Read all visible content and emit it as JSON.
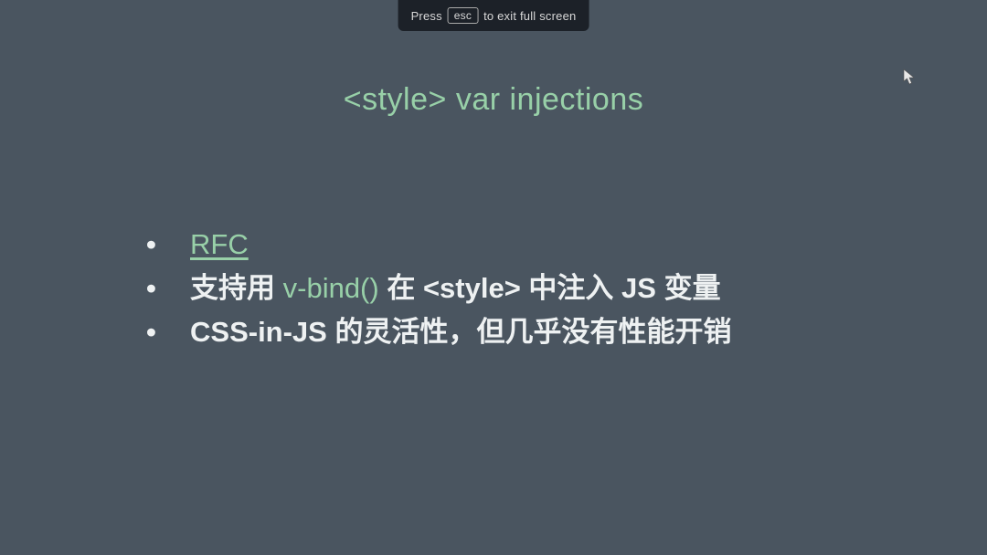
{
  "hint": {
    "press": "Press",
    "key": "esc",
    "rest": "to exit full screen"
  },
  "slide": {
    "title": "<style> var injections",
    "bullets": [
      {
        "parts": [
          {
            "text": "RFC",
            "kind": "link"
          }
        ]
      },
      {
        "parts": [
          {
            "text": "支持用 ",
            "kind": "normal"
          },
          {
            "text": "v-bind()",
            "kind": "accent"
          },
          {
            "text": " 在 <style> 中注入 JS 变量",
            "kind": "normal"
          }
        ]
      },
      {
        "parts": [
          {
            "text": "CSS-in-JS 的灵活性，但几乎没有性能开销",
            "kind": "normal"
          }
        ]
      }
    ]
  }
}
